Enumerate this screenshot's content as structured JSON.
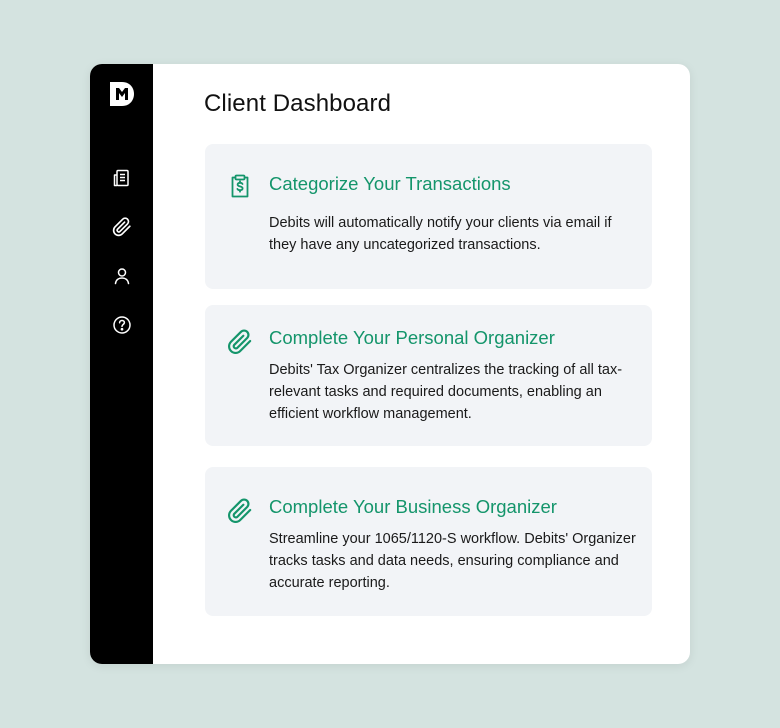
{
  "page": {
    "title": "Client Dashboard"
  },
  "sidebar": {
    "logo": "debits-logo",
    "items": [
      {
        "name": "receipt-icon",
        "label": "Transactions"
      },
      {
        "name": "paperclip-icon",
        "label": "Organizer"
      },
      {
        "name": "user-icon",
        "label": "Profile"
      },
      {
        "name": "help-icon",
        "label": "Help"
      }
    ]
  },
  "cards": [
    {
      "icon": "clipboard-dollar-icon",
      "title": "Categorize Your Transactions",
      "description": "Debits will automatically notify your clients via email if they have any uncategorized transactions."
    },
    {
      "icon": "paperclip-icon",
      "title": "Complete Your Personal Organizer",
      "description": "Debits' Tax Organizer centralizes the tracking of all tax-relevant tasks and required documents, enabling an efficient workflow management."
    },
    {
      "icon": "paperclip-icon",
      "title": "Complete Your Business Organizer",
      "description": "Streamline your 1065/1120-S workflow. Debits' Organizer tracks tasks and data needs, ensuring compliance and accurate reporting."
    }
  ],
  "colors": {
    "background": "#d4e3e0",
    "sidebar": "#000000",
    "accent": "#14956b",
    "card": "#f2f4f7"
  }
}
